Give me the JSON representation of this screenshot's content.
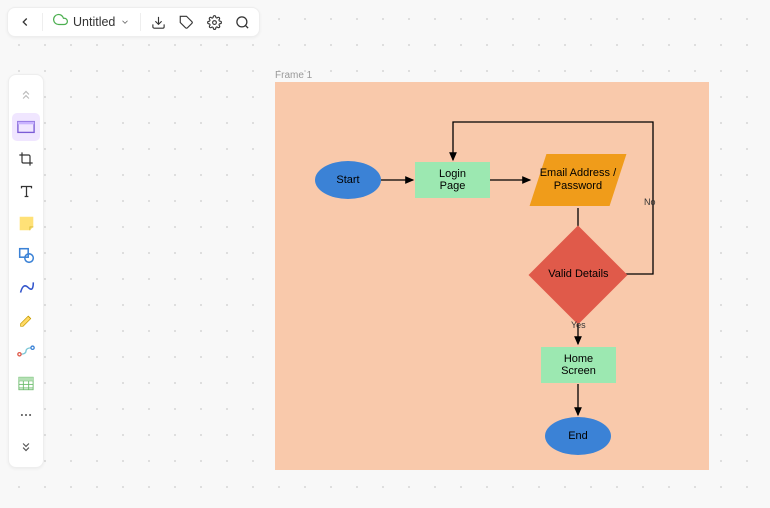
{
  "topbar": {
    "back": "←",
    "title": "Untitled"
  },
  "frame": {
    "label": "Frame 1"
  },
  "nodes": {
    "start": "Start",
    "login": "Login Page",
    "emailpw": "Email Address / Password",
    "valid": "Valid Details",
    "home": "Home Screen",
    "end": "End"
  },
  "edges": {
    "yes": "Yes",
    "no": "No"
  }
}
